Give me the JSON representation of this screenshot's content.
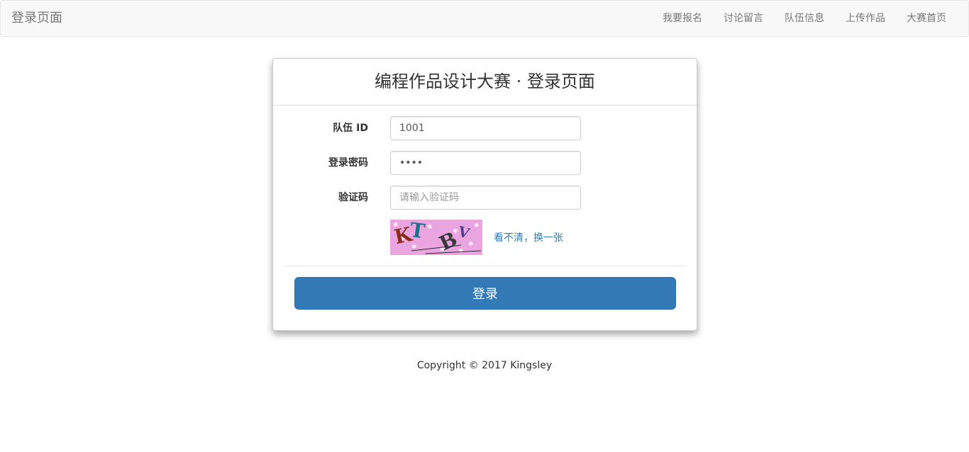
{
  "navbar": {
    "brand": "登录页面",
    "items": [
      {
        "label": "我要报名"
      },
      {
        "label": "讨论留言"
      },
      {
        "label": "队伍信息"
      },
      {
        "label": "上传作品"
      },
      {
        "label": "大赛首页"
      }
    ]
  },
  "panel": {
    "title": "编程作品设计大赛 · 登录页面",
    "fields": {
      "team_id": {
        "label": "队伍 ID",
        "value": "1001",
        "placeholder": ""
      },
      "password": {
        "label": "登录密码",
        "value": "1234",
        "placeholder": ""
      },
      "captcha": {
        "label": "验证码",
        "value": "",
        "placeholder": "请输入验证码"
      }
    },
    "captcha_image": {
      "chars": [
        "K",
        "T",
        "B",
        "V"
      ],
      "background": "#eaa5e0"
    },
    "refresh_label": "看不清，换一张",
    "login_button": "登录"
  },
  "footer": {
    "text": "Copyright © 2017 Kingsley"
  },
  "colors": {
    "primary": "#337ab7",
    "link": "#337ab7",
    "navbar_bg": "#f8f8f8"
  }
}
